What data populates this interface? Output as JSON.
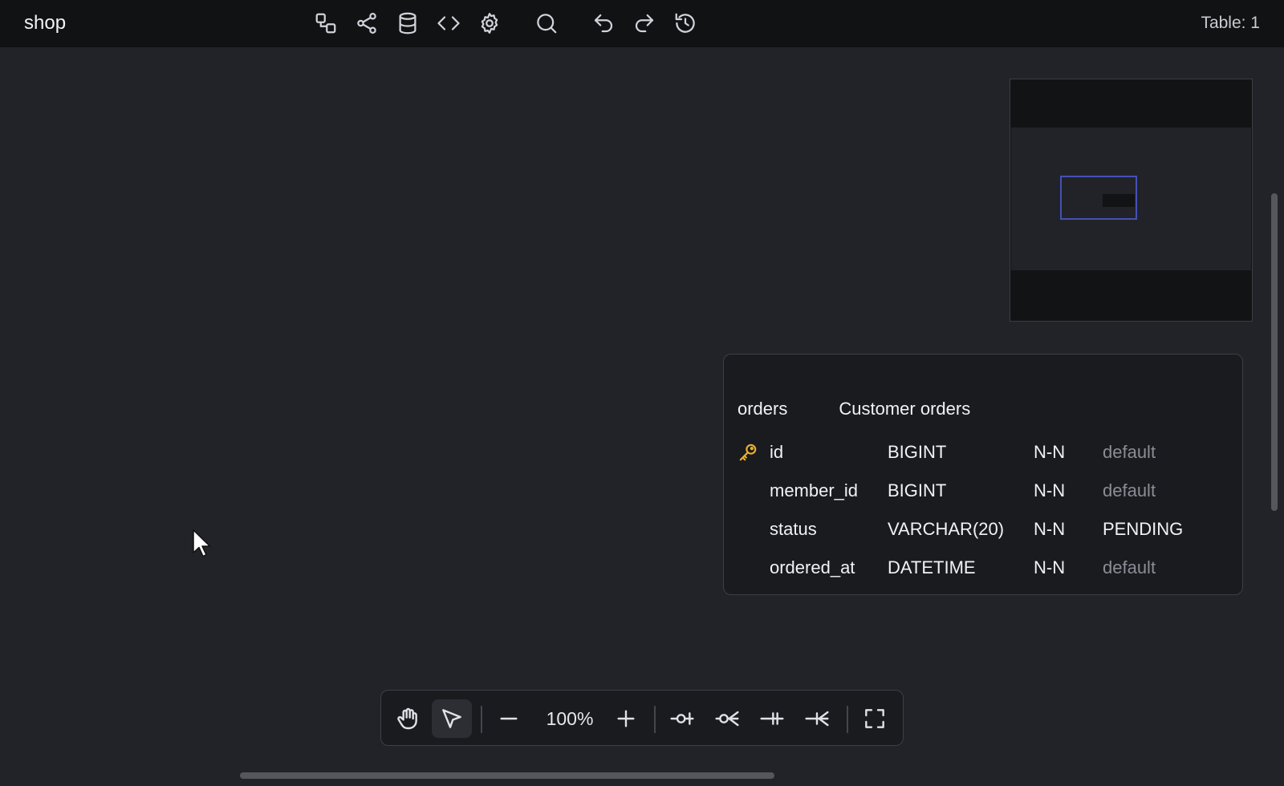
{
  "app": {
    "name": "shop",
    "table_count": "Table: 1"
  },
  "toolbar": {
    "icons": [
      "relations-icon",
      "share-icon",
      "database-icon",
      "code-icon",
      "settings-icon",
      "search-icon",
      "undo-icon",
      "redo-icon",
      "history-icon"
    ]
  },
  "table": {
    "name": "orders",
    "comment": "Customer orders",
    "columns": [
      {
        "name": "id",
        "type": "BIGINT",
        "nullability": "N-N",
        "default": "default",
        "primary_key": true
      },
      {
        "name": "member_id",
        "type": "BIGINT",
        "nullability": "N-N",
        "default": "default",
        "primary_key": false
      },
      {
        "name": "status",
        "type": "VARCHAR(20)",
        "nullability": "N-N",
        "default": "PENDING",
        "primary_key": false
      },
      {
        "name": "ordered_at",
        "type": "DATETIME",
        "nullability": "N-N",
        "default": "default",
        "primary_key": false
      }
    ]
  },
  "bottom_toolbar": {
    "zoom": "100%",
    "tools": [
      "hand-tool",
      "select-tool",
      "zoom-out",
      "zoom-in",
      "one-relation",
      "many-relation",
      "one-one-relation",
      "one-many-relation",
      "fullscreen"
    ]
  },
  "colors": {
    "background": "#222328",
    "topbar": "#111214",
    "primary_key": "#e9b12e",
    "minimap_viewport": "#4550b5"
  }
}
